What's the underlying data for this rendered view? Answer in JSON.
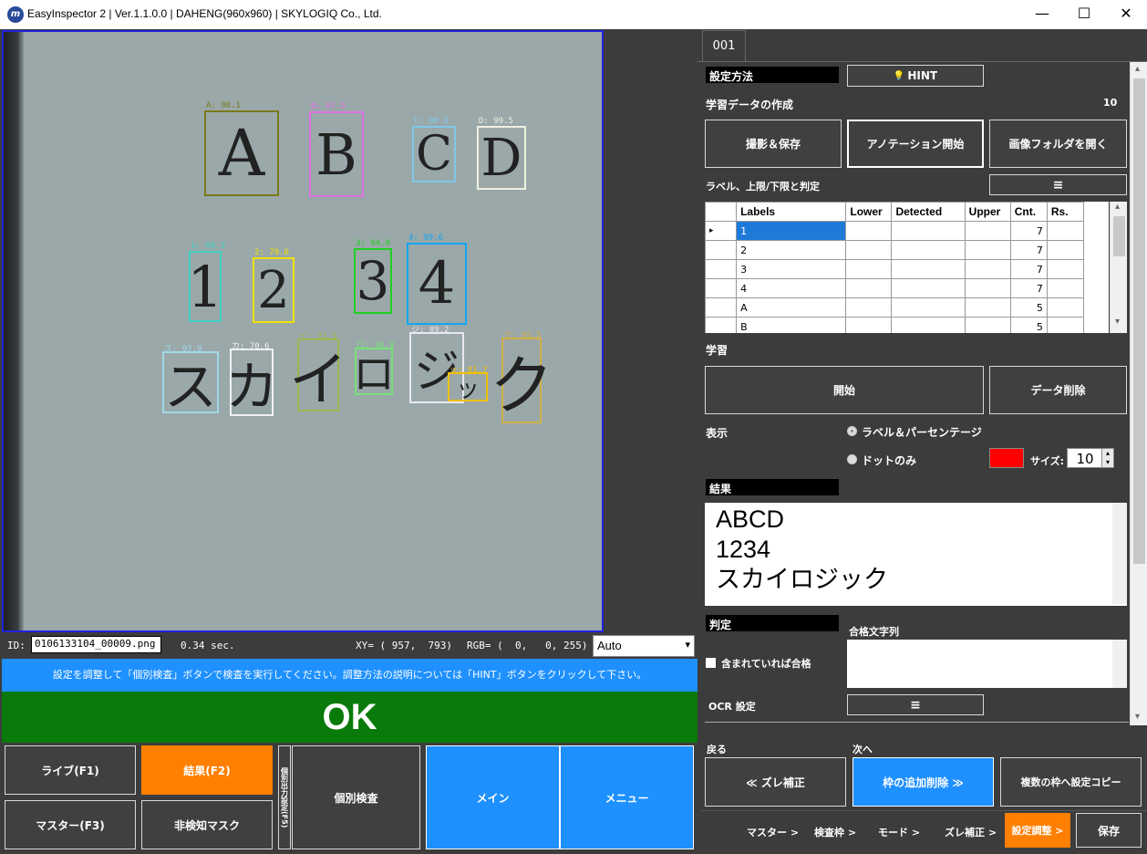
{
  "window": {
    "title": "EasyInspector 2 | Ver.1.1.0.0 | DAHENG(960x960) | SKYLOGIQ Co., Ltd.",
    "logo": "m",
    "minimize": "—",
    "maximize": "☐",
    "close": "✕"
  },
  "detections": [
    {
      "label": "A: 98.1",
      "char": "A",
      "color": "#7a7a1a"
    },
    {
      "label": "B: 97.5",
      "char": "B",
      "color": "#e070e0"
    },
    {
      "label": "C: 98.8",
      "char": "C",
      "color": "#80c8e8"
    },
    {
      "label": "D: 99.5",
      "char": "D",
      "color": "#f0f0e0"
    },
    {
      "label": "1: 99.3",
      "char": "1",
      "color": "#40d0c0"
    },
    {
      "label": "2: 79.6",
      "char": "2",
      "color": "#f0e000"
    },
    {
      "label": "3: 94.8",
      "char": "3",
      "color": "#20d020"
    },
    {
      "label": "4: 99.6",
      "char": "4",
      "color": "#10a8f0"
    },
    {
      "label": "ス: 97.9",
      "char": "ス",
      "color": "#a0d8e8"
    },
    {
      "label": "カ: 70.6",
      "char": "カ",
      "color": "#f0f0f0"
    },
    {
      "label": "イ: 93.9",
      "char": "イ",
      "color": "#98b850"
    },
    {
      "label": "ロ: 98.8",
      "char": "ロ",
      "color": "#78e078"
    },
    {
      "label": "ジ: 89.2",
      "char": "ジ",
      "color": "#e8e8f0"
    },
    {
      "label": "ッ: 81.7",
      "char": "ッ",
      "color": "#f0c000"
    },
    {
      "label": "ク: 95.5",
      "char": "ク",
      "color": "#d0b048"
    }
  ],
  "status": {
    "id_label": "ID:",
    "id_value": "0106133104_00009.png",
    "time": "0.34 sec.",
    "xy": "XY= ( 957,  793)",
    "rgb": "RGB= (  0,   0, 255)",
    "mode": "Auto",
    "dropdown_arrow": "▾"
  },
  "message": "設定を調整して「個別検査」ボタンで検査を実行してください。調整方法の説明については「HINT」ボタンをクリックして下さい。",
  "result_banner": "OK",
  "bottom_buttons": {
    "live": "ライブ(F1)",
    "result": "結果(F2)",
    "master": "マスター(F3)",
    "nondetect": "非検知マスク",
    "vertical": "個別出力設定(F5)",
    "individual": "個別検査",
    "main": "メイン",
    "menu": "メニュー"
  },
  "right": {
    "tab": "001",
    "method_header": "設定方法",
    "hint_icon": "💡",
    "hint": "HINT",
    "training_data": "学習データの作成",
    "training_count": "10",
    "capture_save": "撮影＆保存",
    "annotation_start": "アノテーション開始",
    "open_folder": "画像フォルダを開く",
    "label_limits": "ラベル、上限/下限と判定",
    "menu_icon": "≡",
    "row_indicator": "▸",
    "table": {
      "headers": [
        "Labels",
        "Lower",
        "Detected",
        "Upper",
        "Cnt.",
        "Rs."
      ],
      "rows": [
        [
          "1",
          "",
          "",
          "",
          "7",
          ""
        ],
        [
          "2",
          "",
          "",
          "",
          "7",
          ""
        ],
        [
          "3",
          "",
          "",
          "",
          "7",
          ""
        ],
        [
          "4",
          "",
          "",
          "",
          "7",
          ""
        ],
        [
          "A",
          "",
          "",
          "",
          "5",
          ""
        ],
        [
          "B",
          "",
          "",
          "",
          "5",
          ""
        ]
      ]
    },
    "learning": "学習",
    "start": "開始",
    "delete_data": "データ削除",
    "display": "表示",
    "opt_label_pct": "ラベル＆パーセンテージ",
    "opt_dot": "ドットのみ",
    "dot_color": "#ff0000",
    "size_label": "サイズ:",
    "size_value": "10",
    "spin_up": "▴",
    "spin_down": "▾",
    "result_header": "結果",
    "result_lines": [
      "ABCD",
      "1234",
      "スカイロジック"
    ],
    "judge_header": "判定",
    "pass_string": "合格文字列",
    "contains_pass": "含まれていれば合格",
    "ocr_settings": "OCR 設定",
    "scroll_up": "▴",
    "scroll_down": "▾",
    "back": "戻る",
    "next": "次へ",
    "back_btn": "≪ ズレ補正",
    "next_btn": "枠の追加削除 ≫",
    "copy_btn": "複数の枠へ設定コピー",
    "nav": [
      "マスター >",
      "検査枠 >",
      "モード >",
      "ズレ補正 >"
    ],
    "nav_active": "設定調整 >",
    "save": "保存"
  }
}
